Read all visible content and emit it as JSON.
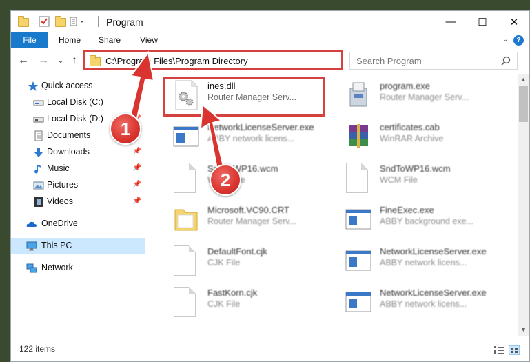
{
  "window": {
    "title": "Program",
    "controls": {
      "minimize": "—",
      "maximize": "☐",
      "close": "✕"
    }
  },
  "ribbon": {
    "tabs": [
      {
        "label": "File"
      },
      {
        "label": "Home"
      },
      {
        "label": "Share"
      },
      {
        "label": "View"
      }
    ],
    "help": "?",
    "expand": "⌄"
  },
  "nav": {
    "back": "←",
    "forward": "→",
    "recent": "⌄",
    "up": "↑",
    "address": "C:\\Program Files\\Program Directory",
    "address_dropdown": "⌄",
    "refresh": "↻",
    "search_placeholder": "Search Program"
  },
  "sidebar": {
    "items": [
      {
        "label": "Quick access",
        "icon": "star-icon",
        "pinned": false
      },
      {
        "label": "Local Disk (C:)",
        "icon": "drive-icon",
        "pinned": true
      },
      {
        "label": "Local Disk (D:)",
        "icon": "drive-icon",
        "pinned": true
      },
      {
        "label": "Documents",
        "icon": "documents-icon",
        "pinned": true
      },
      {
        "label": "Downloads",
        "icon": "download-icon",
        "pinned": true
      },
      {
        "label": "Music",
        "icon": "music-icon",
        "pinned": true
      },
      {
        "label": "Pictures",
        "icon": "pictures-icon",
        "pinned": true
      },
      {
        "label": "Videos",
        "icon": "videos-icon",
        "pinned": true
      },
      {
        "label": "OneDrive",
        "icon": "onedrive-icon",
        "pinned": false
      },
      {
        "label": "This PC",
        "icon": "computer-icon",
        "pinned": false,
        "selected": true
      },
      {
        "label": "Network",
        "icon": "network-icon",
        "pinned": false
      }
    ],
    "pin_glyph": "📌"
  },
  "files": [
    {
      "name": "ines.dll",
      "type": "Router Manager Serv...",
      "icon": "dll-gear-icon"
    },
    {
      "name": "program.exe",
      "type": "Router Manager Serv...",
      "icon": "installer-icon"
    },
    {
      "name": "NetworkLicenseServer.exe",
      "type": "ABBY network licens...",
      "icon": "app-window-icon"
    },
    {
      "name": "certificates.cab",
      "type": "WinRAR Archive",
      "icon": "archive-icon"
    },
    {
      "name": "SndToWP16.wcm",
      "type": "WCM File",
      "icon": "document-icon"
    },
    {
      "name": "SndToWP16.wcm",
      "type": "WCM File",
      "icon": "document-icon"
    },
    {
      "name": "Microsoft.VC90.CRT",
      "type": "Router Manager Serv...",
      "icon": "folder-icon"
    },
    {
      "name": "FineExec.exe",
      "type": "ABBY background exe...",
      "icon": "app-window-icon"
    },
    {
      "name": "DefaultFont.cjk",
      "type": "CJK File",
      "icon": "document-icon"
    },
    {
      "name": "NetworkLicenseServer.exe",
      "type": "ABBY network licens...",
      "icon": "app-window-icon"
    },
    {
      "name": "FastKorn.cjk",
      "type": "CJK File",
      "icon": "document-icon"
    },
    {
      "name": "NetworkLicenseServer.exe",
      "type": "ABBY network licens...",
      "icon": "app-window-icon"
    }
  ],
  "status": {
    "item_count": "122 items"
  },
  "annotations": {
    "badge_1": "1",
    "badge_2": "2",
    "accent": "#d5413f"
  },
  "colors": {
    "file_tab": "#1979ca",
    "selected_nav": "#cce8ff"
  }
}
